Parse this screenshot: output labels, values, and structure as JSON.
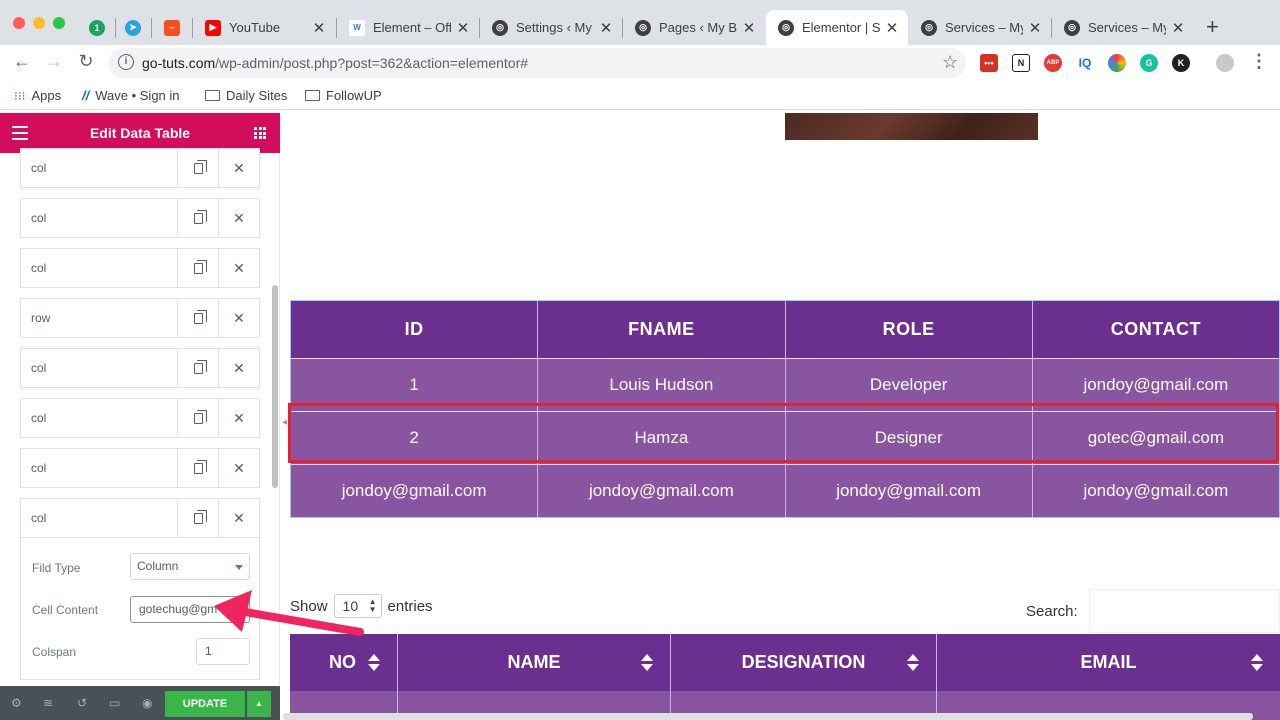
{
  "browser": {
    "tabs": [
      {
        "label": "YouTube"
      },
      {
        "label": "Element – Off"
      },
      {
        "label": "Settings ‹ My"
      },
      {
        "label": "Pages ‹ My Bl"
      },
      {
        "label": "Elementor | S"
      },
      {
        "label": "Services – My"
      },
      {
        "label": "Services – My"
      }
    ],
    "close_glyph": "✕",
    "new_tab": "+",
    "url_host": "go-tuts.com",
    "url_path": "/wp-admin/post.php?post=362&action=elementor#",
    "bookmarks": {
      "apps": "Apps",
      "wave": "Wave • Sign in",
      "daily": "Daily Sites",
      "followup": "FollowUP"
    },
    "ext_labels": [
      "•••",
      "N",
      "ABP",
      "IQ",
      "",
      "G",
      "K"
    ]
  },
  "panel": {
    "title": "Edit Data Table",
    "items": [
      "col",
      "col",
      "col",
      "row",
      "col",
      "col",
      "col",
      "col"
    ],
    "fields": {
      "field_type_label": "Fild Type",
      "field_type_value": "Column",
      "cell_content_label": "Cell Content",
      "cell_content_value": "gotechug@gm",
      "colspan_label": "Colspan",
      "colspan_value": "1"
    },
    "update_label": "UPDATE"
  },
  "table1": {
    "headers": [
      "ID",
      "FNAME",
      "ROLE",
      "CONTACT"
    ],
    "rows": [
      [
        "1",
        "Louis Hudson",
        "Developer",
        "jondoy@gmail.com"
      ],
      [
        "2",
        "Hamza",
        "Designer",
        "gotec@gmail.com"
      ],
      [
        "jondoy@gmail.com",
        "jondoy@gmail.com",
        "jondoy@gmail.com",
        "jondoy@gmail.com"
      ]
    ]
  },
  "table2": {
    "show": "Show",
    "entries_value": "10",
    "entries": "entries",
    "search": "Search:",
    "headers": [
      "NO",
      "NAME",
      "DESIGNATION",
      "EMAIL"
    ]
  },
  "colors": {
    "elementor_pink": "#d30c5c",
    "table_header": "#6b2f8f",
    "table_body": "#8954a0",
    "highlight_red": "#e8202d",
    "update_green": "#39b54a"
  }
}
